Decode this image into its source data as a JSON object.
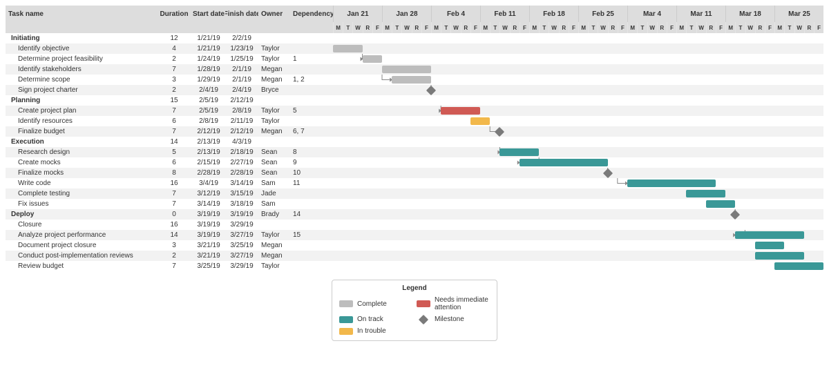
{
  "headers": {
    "task": "Task name",
    "duration": "Duration",
    "start": "Start date",
    "finish": "Finish date",
    "owner": "Owner",
    "dependency": "Dependency"
  },
  "weeks": [
    "Jan 21",
    "Jan 28",
    "Feb 4",
    "Feb 11",
    "Feb 18",
    "Feb 25",
    "Mar 4",
    "Mar 11",
    "Mar 18",
    "Mar 25"
  ],
  "days5": [
    "M",
    "T",
    "W",
    "R",
    "F"
  ],
  "legend": {
    "title": "Legend",
    "complete": "Complete",
    "ontrack": "On track",
    "trouble": "In trouble",
    "needs": "Needs immediate attention",
    "milestone": "Milestone"
  },
  "rows": [
    {
      "type": "group",
      "name": "Initiating",
      "dur": "12",
      "start": "1/21/19",
      "finish": "2/2/19",
      "owner": "",
      "dep": ""
    },
    {
      "type": "task",
      "name": "Identify objective",
      "dur": "4",
      "start": "1/21/19",
      "finish": "1/23/19",
      "owner": "Taylor",
      "dep": "",
      "bar": {
        "start": 0,
        "len": 3,
        "color": "complete"
      }
    },
    {
      "type": "task",
      "name": "Determine project feasibility",
      "dur": "2",
      "start": "1/24/19",
      "finish": "1/25/19",
      "owner": "Taylor",
      "dep": "1",
      "bar": {
        "start": 3,
        "len": 2,
        "color": "complete"
      },
      "depArrow": {
        "fromCol": 3,
        "fromRow": -1
      }
    },
    {
      "type": "task",
      "name": "Identify stakeholders",
      "dur": "7",
      "start": "1/28/19",
      "finish": "2/1/19",
      "owner": "Megan",
      "dep": "",
      "bar": {
        "start": 5,
        "len": 5,
        "color": "complete"
      }
    },
    {
      "type": "task",
      "name": "Determine scope",
      "dur": "3",
      "start": "1/29/19",
      "finish": "2/1/19",
      "owner": "Megan",
      "dep": "1, 2",
      "bar": {
        "start": 6,
        "len": 4,
        "color": "complete"
      },
      "depArrow": {
        "fromCol": 5,
        "fromRow": -2
      }
    },
    {
      "type": "task",
      "name": "Sign project charter",
      "dur": "2",
      "start": "2/4/19",
      "finish": "2/4/19",
      "owner": "Bryce",
      "dep": "",
      "milestone": {
        "col": 10
      },
      "depArrow": {
        "fromCol": 10,
        "fromRow": -1
      }
    },
    {
      "type": "group",
      "name": "Planning",
      "dur": "15",
      "start": "2/5/19",
      "finish": "2/12/19",
      "owner": "",
      "dep": ""
    },
    {
      "type": "task",
      "name": "Create project plan",
      "dur": "7",
      "start": "2/5/19",
      "finish": "2/8/19",
      "owner": "Taylor",
      "dep": "5",
      "bar": {
        "start": 11,
        "len": 4,
        "color": "needs"
      },
      "depArrow": {
        "fromCol": 11,
        "fromRow": -2
      }
    },
    {
      "type": "task",
      "name": "Identify resources",
      "dur": "6",
      "start": "2/8/19",
      "finish": "2/11/19",
      "owner": "Taylor",
      "dep": "",
      "bar": {
        "start": 14,
        "len": 2,
        "color": "trouble"
      }
    },
    {
      "type": "task",
      "name": "Finalize budget",
      "dur": "7",
      "start": "2/12/19",
      "finish": "2/12/19",
      "owner": "Megan",
      "dep": "6, 7",
      "milestone": {
        "col": 17
      },
      "depArrow": {
        "fromCol": 16,
        "fromRow": -1
      }
    },
    {
      "type": "group",
      "name": "Execution",
      "dur": "14",
      "start": "2/13/19",
      "finish": "4/3/19",
      "owner": "",
      "dep": ""
    },
    {
      "type": "task",
      "name": "Research design",
      "dur": "5",
      "start": "2/13/19",
      "finish": "2/18/19",
      "owner": "Sean",
      "dep": "8",
      "bar": {
        "start": 17,
        "len": 4,
        "color": "ontrack"
      },
      "depArrow": {
        "fromCol": 17,
        "fromRow": -2
      }
    },
    {
      "type": "task",
      "name": "Create mocks",
      "dur": "6",
      "start": "2/15/19",
      "finish": "2/27/19",
      "owner": "Sean",
      "dep": "9",
      "bar": {
        "start": 19,
        "len": 9,
        "color": "ontrack"
      },
      "depArrow": {
        "fromCol": 21,
        "fromRow": -1
      }
    },
    {
      "type": "task",
      "name": "Finalize mocks",
      "dur": "8",
      "start": "2/28/19",
      "finish": "2/28/19",
      "owner": "Sean",
      "dep": "10",
      "milestone": {
        "col": 28
      },
      "depArrow": {
        "fromCol": 28,
        "fromRow": -1
      }
    },
    {
      "type": "task",
      "name": "Write code",
      "dur": "16",
      "start": "3/4/19",
      "finish": "3/14/19",
      "owner": "Sam",
      "dep": "11",
      "bar": {
        "start": 30,
        "len": 9,
        "color": "ontrack"
      },
      "depArrow": {
        "fromCol": 29,
        "fromRow": -1
      }
    },
    {
      "type": "task",
      "name": "Complete testing",
      "dur": "7",
      "start": "3/12/19",
      "finish": "3/15/19",
      "owner": "Jade",
      "dep": "",
      "bar": {
        "start": 36,
        "len": 4,
        "color": "ontrack"
      }
    },
    {
      "type": "task",
      "name": "Fix issues",
      "dur": "7",
      "start": "3/14/19",
      "finish": "3/18/19",
      "owner": "Sam",
      "dep": "",
      "bar": {
        "start": 38,
        "len": 3,
        "color": "ontrack"
      }
    },
    {
      "type": "group",
      "name": "Deploy",
      "dur": "0",
      "start": "3/19/19",
      "finish": "3/19/19",
      "owner": "Brady",
      "dep": "14",
      "milestone": {
        "col": 41
      },
      "depArrow": {
        "fromCol": 41,
        "fromRow": -1
      }
    },
    {
      "type": "task",
      "name": "Closure",
      "dur": "16",
      "start": "3/19/19",
      "finish": "3/29/19",
      "owner": "",
      "dep": ""
    },
    {
      "type": "task",
      "name": "Analyze project performance",
      "dur": "14",
      "start": "3/19/19",
      "finish": "3/27/19",
      "owner": "Taylor",
      "dep": "15",
      "bar": {
        "start": 41,
        "len": 7,
        "color": "ontrack"
      },
      "depArrow": {
        "fromCol": 42,
        "fromRow": -2
      }
    },
    {
      "type": "task",
      "name": "Document project closure",
      "dur": "3",
      "start": "3/21/19",
      "finish": "3/25/19",
      "owner": "Megan",
      "dep": "",
      "bar": {
        "start": 43,
        "len": 3,
        "color": "ontrack"
      }
    },
    {
      "type": "task",
      "name": "Conduct post-implementation reviews",
      "dur": "2",
      "start": "3/21/19",
      "finish": "3/27/19",
      "owner": "Megan",
      "dep": "",
      "bar": {
        "start": 43,
        "len": 5,
        "color": "ontrack"
      }
    },
    {
      "type": "task",
      "name": "Review budget",
      "dur": "7",
      "start": "3/25/19",
      "finish": "3/29/19",
      "owner": "Taylor",
      "dep": "",
      "bar": {
        "start": 45,
        "len": 5,
        "color": "ontrack"
      }
    }
  ],
  "chart_data": {
    "type": "gantt",
    "title": "",
    "date_range": [
      "2019-01-21",
      "2019-03-29"
    ],
    "columns_per_week": 5,
    "weeks": [
      "Jan 21",
      "Jan 28",
      "Feb 4",
      "Feb 11",
      "Feb 18",
      "Feb 25",
      "Mar 4",
      "Mar 11",
      "Mar 18",
      "Mar 25"
    ],
    "status_colors": {
      "complete": "#bdbdbd",
      "ontrack": "#3a9897",
      "trouble": "#f2b84b",
      "needs": "#d05a54",
      "milestone": "#7a7a7a"
    },
    "tasks": [
      {
        "id": 1,
        "group": "Initiating",
        "name": "Identify objective",
        "duration": 4,
        "start": "2019-01-21",
        "finish": "2019-01-23",
        "owner": "Taylor",
        "dependencies": [],
        "status": "complete"
      },
      {
        "id": 2,
        "group": "Initiating",
        "name": "Determine project feasibility",
        "duration": 2,
        "start": "2019-01-24",
        "finish": "2019-01-25",
        "owner": "Taylor",
        "dependencies": [
          1
        ],
        "status": "complete"
      },
      {
        "id": 3,
        "group": "Initiating",
        "name": "Identify stakeholders",
        "duration": 7,
        "start": "2019-01-28",
        "finish": "2019-02-01",
        "owner": "Megan",
        "dependencies": [],
        "status": "complete"
      },
      {
        "id": 4,
        "group": "Initiating",
        "name": "Determine scope",
        "duration": 3,
        "start": "2019-01-29",
        "finish": "2019-02-01",
        "owner": "Megan",
        "dependencies": [
          1,
          2
        ],
        "status": "complete"
      },
      {
        "id": 5,
        "group": "Initiating",
        "name": "Sign project charter",
        "duration": 2,
        "start": "2019-02-04",
        "finish": "2019-02-04",
        "owner": "Bryce",
        "dependencies": [],
        "status": "milestone"
      },
      {
        "id": 6,
        "group": "Planning",
        "name": "Create project plan",
        "duration": 7,
        "start": "2019-02-05",
        "finish": "2019-02-08",
        "owner": "Taylor",
        "dependencies": [
          5
        ],
        "status": "needs"
      },
      {
        "id": 7,
        "group": "Planning",
        "name": "Identify resources",
        "duration": 6,
        "start": "2019-02-08",
        "finish": "2019-02-11",
        "owner": "Taylor",
        "dependencies": [],
        "status": "trouble"
      },
      {
        "id": 8,
        "group": "Planning",
        "name": "Finalize budget",
        "duration": 7,
        "start": "2019-02-12",
        "finish": "2019-02-12",
        "owner": "Megan",
        "dependencies": [
          6,
          7
        ],
        "status": "milestone"
      },
      {
        "id": 9,
        "group": "Execution",
        "name": "Research design",
        "duration": 5,
        "start": "2019-02-13",
        "finish": "2019-02-18",
        "owner": "Sean",
        "dependencies": [
          8
        ],
        "status": "ontrack"
      },
      {
        "id": 10,
        "group": "Execution",
        "name": "Create mocks",
        "duration": 6,
        "start": "2019-02-15",
        "finish": "2019-02-27",
        "owner": "Sean",
        "dependencies": [
          9
        ],
        "status": "ontrack"
      },
      {
        "id": 11,
        "group": "Execution",
        "name": "Finalize mocks",
        "duration": 8,
        "start": "2019-02-28",
        "finish": "2019-02-28",
        "owner": "Sean",
        "dependencies": [
          10
        ],
        "status": "milestone"
      },
      {
        "id": 12,
        "group": "Execution",
        "name": "Write code",
        "duration": 16,
        "start": "2019-03-04",
        "finish": "2019-03-14",
        "owner": "Sam",
        "dependencies": [
          11
        ],
        "status": "ontrack"
      },
      {
        "id": 13,
        "group": "Execution",
        "name": "Complete testing",
        "duration": 7,
        "start": "2019-03-12",
        "finish": "2019-03-15",
        "owner": "Jade",
        "dependencies": [],
        "status": "ontrack"
      },
      {
        "id": 14,
        "group": "Execution",
        "name": "Fix issues",
        "duration": 7,
        "start": "2019-03-14",
        "finish": "2019-03-18",
        "owner": "Sam",
        "dependencies": [],
        "status": "ontrack"
      },
      {
        "id": 15,
        "group": "Deploy",
        "name": "Deploy",
        "duration": 0,
        "start": "2019-03-19",
        "finish": "2019-03-19",
        "owner": "Brady",
        "dependencies": [
          14
        ],
        "status": "milestone"
      },
      {
        "id": 16,
        "group": "Deploy",
        "name": "Closure",
        "duration": 16,
        "start": "2019-03-19",
        "finish": "2019-03-29",
        "owner": "",
        "dependencies": [],
        "status": ""
      },
      {
        "id": 17,
        "group": "Deploy",
        "name": "Analyze project performance",
        "duration": 14,
        "start": "2019-03-19",
        "finish": "2019-03-27",
        "owner": "Taylor",
        "dependencies": [
          15
        ],
        "status": "ontrack"
      },
      {
        "id": 18,
        "group": "Deploy",
        "name": "Document project closure",
        "duration": 3,
        "start": "2019-03-21",
        "finish": "2019-03-25",
        "owner": "Megan",
        "dependencies": [],
        "status": "ontrack"
      },
      {
        "id": 19,
        "group": "Deploy",
        "name": "Conduct post-implementation reviews",
        "duration": 2,
        "start": "2019-03-21",
        "finish": "2019-03-27",
        "owner": "Megan",
        "dependencies": [],
        "status": "ontrack"
      },
      {
        "id": 20,
        "group": "Deploy",
        "name": "Review budget",
        "duration": 7,
        "start": "2019-03-25",
        "finish": "2019-03-29",
        "owner": "Taylor",
        "dependencies": [],
        "status": "ontrack"
      }
    ]
  }
}
